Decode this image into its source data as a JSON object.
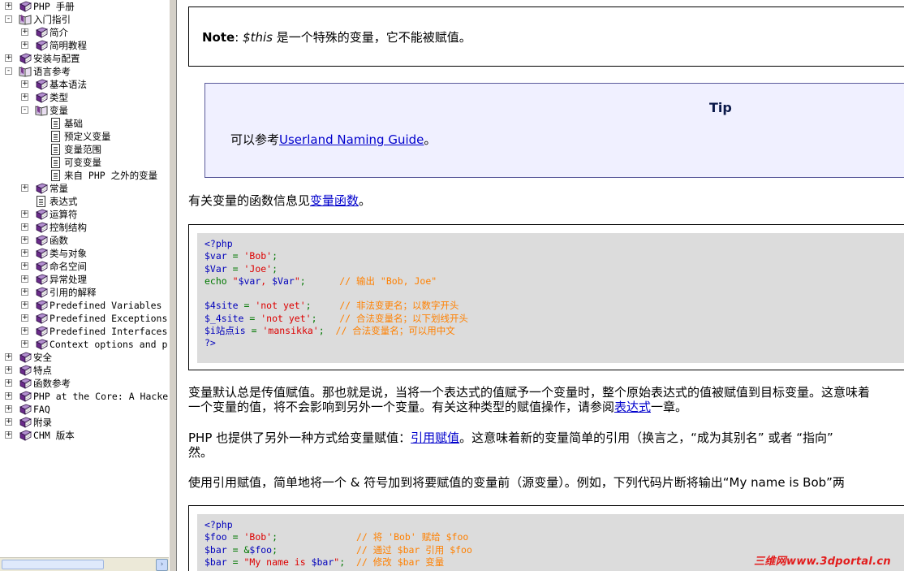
{
  "sidebar": {
    "items": [
      {
        "label": "PHP 手册",
        "expander": "+",
        "icon": "book-closed-icon"
      },
      {
        "label": "入门指引",
        "expander": "-",
        "icon": "book-open-icon"
      },
      {
        "label": "简介",
        "expander": "+",
        "icon": "book-closed-icon"
      },
      {
        "label": "简明教程",
        "expander": "+",
        "icon": "book-closed-icon"
      },
      {
        "label": "安装与配置",
        "expander": "+",
        "icon": "book-closed-icon"
      },
      {
        "label": "语言参考",
        "expander": "-",
        "icon": "book-open-icon"
      },
      {
        "label": "基本语法",
        "expander": "+",
        "icon": "book-closed-icon"
      },
      {
        "label": "类型",
        "expander": "+",
        "icon": "book-closed-icon"
      },
      {
        "label": "变量",
        "expander": "-",
        "icon": "book-open-icon"
      },
      {
        "label": "基础",
        "expander": "",
        "icon": "page-icon"
      },
      {
        "label": "预定义变量",
        "expander": "",
        "icon": "page-icon"
      },
      {
        "label": "变量范围",
        "expander": "",
        "icon": "page-icon"
      },
      {
        "label": "可变变量",
        "expander": "",
        "icon": "page-icon"
      },
      {
        "label": "来自 PHP 之外的变量",
        "expander": "",
        "icon": "page-icon"
      },
      {
        "label": "常量",
        "expander": "+",
        "icon": "book-closed-icon"
      },
      {
        "label": "表达式",
        "expander": "",
        "icon": "page-icon"
      },
      {
        "label": "运算符",
        "expander": "+",
        "icon": "book-closed-icon"
      },
      {
        "label": "控制结构",
        "expander": "+",
        "icon": "book-closed-icon"
      },
      {
        "label": "函数",
        "expander": "+",
        "icon": "book-closed-icon"
      },
      {
        "label": "类与对象",
        "expander": "+",
        "icon": "book-closed-icon"
      },
      {
        "label": "命名空间",
        "expander": "+",
        "icon": "book-closed-icon"
      },
      {
        "label": "异常处理",
        "expander": "+",
        "icon": "book-closed-icon"
      },
      {
        "label": "引用的解释",
        "expander": "+",
        "icon": "book-closed-icon"
      },
      {
        "label": "Predefined Variables",
        "expander": "+",
        "icon": "book-closed-icon"
      },
      {
        "label": "Predefined Exceptions",
        "expander": "+",
        "icon": "book-closed-icon"
      },
      {
        "label": "Predefined Interfaces",
        "expander": "+",
        "icon": "book-closed-icon"
      },
      {
        "label": "Context options and p",
        "expander": "+",
        "icon": "book-closed-icon"
      },
      {
        "label": "安全",
        "expander": "+",
        "icon": "book-closed-icon"
      },
      {
        "label": "特点",
        "expander": "+",
        "icon": "book-closed-icon"
      },
      {
        "label": "函数参考",
        "expander": "+",
        "icon": "book-closed-icon"
      },
      {
        "label": "PHP at the Core: A Hacke",
        "expander": "+",
        "icon": "book-closed-icon"
      },
      {
        "label": "FAQ",
        "expander": "+",
        "icon": "book-closed-icon"
      },
      {
        "label": "附录",
        "expander": "+",
        "icon": "book-closed-icon"
      },
      {
        "label": "CHM 版本",
        "expander": "+",
        "icon": "book-closed-icon"
      }
    ],
    "scroll_right_arrow": "›"
  },
  "content": {
    "note": {
      "label": "Note",
      "colon": ": ",
      "var": "$this",
      "text": " 是一个特殊的变量，它不能被赋值。"
    },
    "tip": {
      "title": "Tip",
      "prefix": "可以参考",
      "link": "Userland Naming Guide",
      "suffix": "。"
    },
    "functions_para": {
      "prefix": "有关变量的函数信息见",
      "link": "变量函数",
      "suffix": "。"
    },
    "code1": [
      [
        {
          "t": "<?php",
          "c": "k"
        }
      ],
      [
        {
          "t": "$var ",
          "c": "k"
        },
        {
          "t": "= ",
          "c": "g"
        },
        {
          "t": "'Bob'",
          "c": "s"
        },
        {
          "t": ";",
          "c": "g"
        }
      ],
      [
        {
          "t": "$Var ",
          "c": "k"
        },
        {
          "t": "= ",
          "c": "g"
        },
        {
          "t": "'Joe'",
          "c": "s"
        },
        {
          "t": ";",
          "c": "g"
        }
      ],
      [
        {
          "t": "echo ",
          "c": "g"
        },
        {
          "t": "\"",
          "c": "s"
        },
        {
          "t": "$var",
          "c": "k"
        },
        {
          "t": ", ",
          "c": "s"
        },
        {
          "t": "$Var",
          "c": "k"
        },
        {
          "t": "\"",
          "c": "s"
        },
        {
          "t": ";      ",
          "c": "g"
        },
        {
          "t": "// 输出 \"Bob, Joe\"",
          "c": "c"
        }
      ],
      [
        {
          "t": "",
          "c": "k"
        }
      ],
      [
        {
          "t": "$4site ",
          "c": "k"
        },
        {
          "t": "= ",
          "c": "g"
        },
        {
          "t": "'not yet'",
          "c": "s"
        },
        {
          "t": ";     ",
          "c": "g"
        },
        {
          "t": "// 非法变更名；以数字开头",
          "c": "c"
        }
      ],
      [
        {
          "t": "$_4site ",
          "c": "k"
        },
        {
          "t": "= ",
          "c": "g"
        },
        {
          "t": "'not yet'",
          "c": "s"
        },
        {
          "t": ";    ",
          "c": "g"
        },
        {
          "t": "// 合法变量名；以下划线开头",
          "c": "c"
        }
      ],
      [
        {
          "t": "$i站点is ",
          "c": "k"
        },
        {
          "t": "= ",
          "c": "g"
        },
        {
          "t": "'mansikka'",
          "c": "s"
        },
        {
          "t": ";  ",
          "c": "g"
        },
        {
          "t": "// 合法变量名；可以用中文",
          "c": "c"
        }
      ],
      [
        {
          "t": "?>",
          "c": "k"
        }
      ]
    ],
    "value_para": {
      "line1": "变量默认总是传值赋值。那也就是说，当将一个表达式的值赋予一个变量时，整个原始表达式的值被赋值到目标变量。这意味着",
      "line2_prefix": "一个变量的值，将不会影响到另外一个变量。有关这种类型的赋值操作，请参阅",
      "line2_link": "表达式",
      "line2_suffix": "一章。"
    },
    "ref_para": {
      "prefix": "PHP 也提供了另外一种方式给变量赋值：",
      "link": "引用赋值",
      "suffix": "。这意味着新的变量简单的引用（换言之，“成为其别名” 或者 “指向”",
      "line2": "然。"
    },
    "usage_para": "使用引用赋值，简单地将一个 & 符号加到将要赋值的变量前（源变量）。例如，下列代码片断将输出“My name is Bob”两",
    "code2": [
      [
        {
          "t": "<?php",
          "c": "k"
        }
      ],
      [
        {
          "t": "$foo ",
          "c": "k"
        },
        {
          "t": "= ",
          "c": "g"
        },
        {
          "t": "'Bob'",
          "c": "s"
        },
        {
          "t": ";              ",
          "c": "g"
        },
        {
          "t": "// 将 'Bob' 赋给 $foo",
          "c": "c"
        }
      ],
      [
        {
          "t": "$bar ",
          "c": "k"
        },
        {
          "t": "= &",
          "c": "g"
        },
        {
          "t": "$foo",
          "c": "k"
        },
        {
          "t": ";              ",
          "c": "g"
        },
        {
          "t": "// 通过 $bar 引用 $foo",
          "c": "c"
        }
      ],
      [
        {
          "t": "$bar ",
          "c": "k"
        },
        {
          "t": "= ",
          "c": "g"
        },
        {
          "t": "\"My name is ",
          "c": "s"
        },
        {
          "t": "$bar",
          "c": "k"
        },
        {
          "t": "\"",
          "c": "s"
        },
        {
          "t": ";  ",
          "c": "g"
        },
        {
          "t": "// 修改 $bar 变量",
          "c": "c"
        }
      ]
    ]
  },
  "watermark": "三维网www.3dportal.cn",
  "colors": {
    "code_bg": "#dcdcdc",
    "tip_bg": "#f0f0ff",
    "link": "#0000cc",
    "keyword": "#0000bb",
    "default": "#007700",
    "string": "#dd0000",
    "comment": "#ff8000"
  }
}
